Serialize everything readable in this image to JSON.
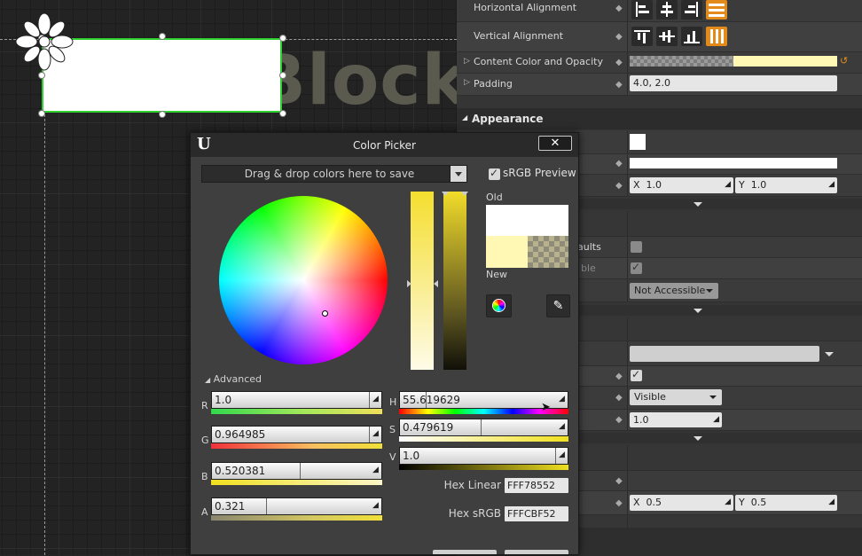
{
  "canvas": {
    "ghost_text": "Text Block"
  },
  "details": {
    "horizontal_alignment_label": "Horizontal Alignment",
    "vertical_alignment_label": "Vertical Alignment",
    "content_color_label": "Content Color and Opacity",
    "padding_label": "Padding",
    "padding_value": "4.0, 2.0",
    "appearance_header": "Appearance",
    "scale_x_label": "X",
    "scale_x_value": "1.0",
    "scale_y_label": "Y",
    "scale_y_value": "1.0",
    "partial_label_defaults": "aults",
    "partial_label_able": "ble",
    "accessibility_value": "Not Accessible",
    "visibility_value": "Visible",
    "opacity_value": "1.0",
    "pivot_x_label": "X",
    "pivot_x_value": "0.5",
    "pivot_y_label": "Y",
    "pivot_y_value": "0.5"
  },
  "picker": {
    "title": "Color Picker",
    "save_bar_text": "Drag & drop colors here to save",
    "srgb_preview_label": "sRGB Preview",
    "old_label": "Old",
    "new_label": "New",
    "advanced_label": "Advanced",
    "channels": {
      "r": {
        "letter": "R",
        "value": "1.0",
        "fraction": 1.0
      },
      "g": {
        "letter": "G",
        "value": "0.964985",
        "fraction": 0.965
      },
      "b": {
        "letter": "B",
        "value": "0.520381",
        "fraction": 0.52
      },
      "a": {
        "letter": "A",
        "value": "0.321",
        "fraction": 0.321
      },
      "h": {
        "letter": "H",
        "value": "55.619629",
        "fraction": 0.155
      },
      "s": {
        "letter": "S",
        "value": "0.479619",
        "fraction": 0.48
      },
      "v": {
        "letter": "V",
        "value": "1.0",
        "fraction": 1.0
      }
    },
    "hex_linear_label": "Hex Linear",
    "hex_linear_value": "FFF78552",
    "hex_srgb_label": "Hex sRGB",
    "hex_srgb_value": "FFFCBF52"
  },
  "colors": {
    "accent_orange": "#e38a1b",
    "selection_green": "#2fd02f",
    "new_color": "#fff8b5"
  }
}
